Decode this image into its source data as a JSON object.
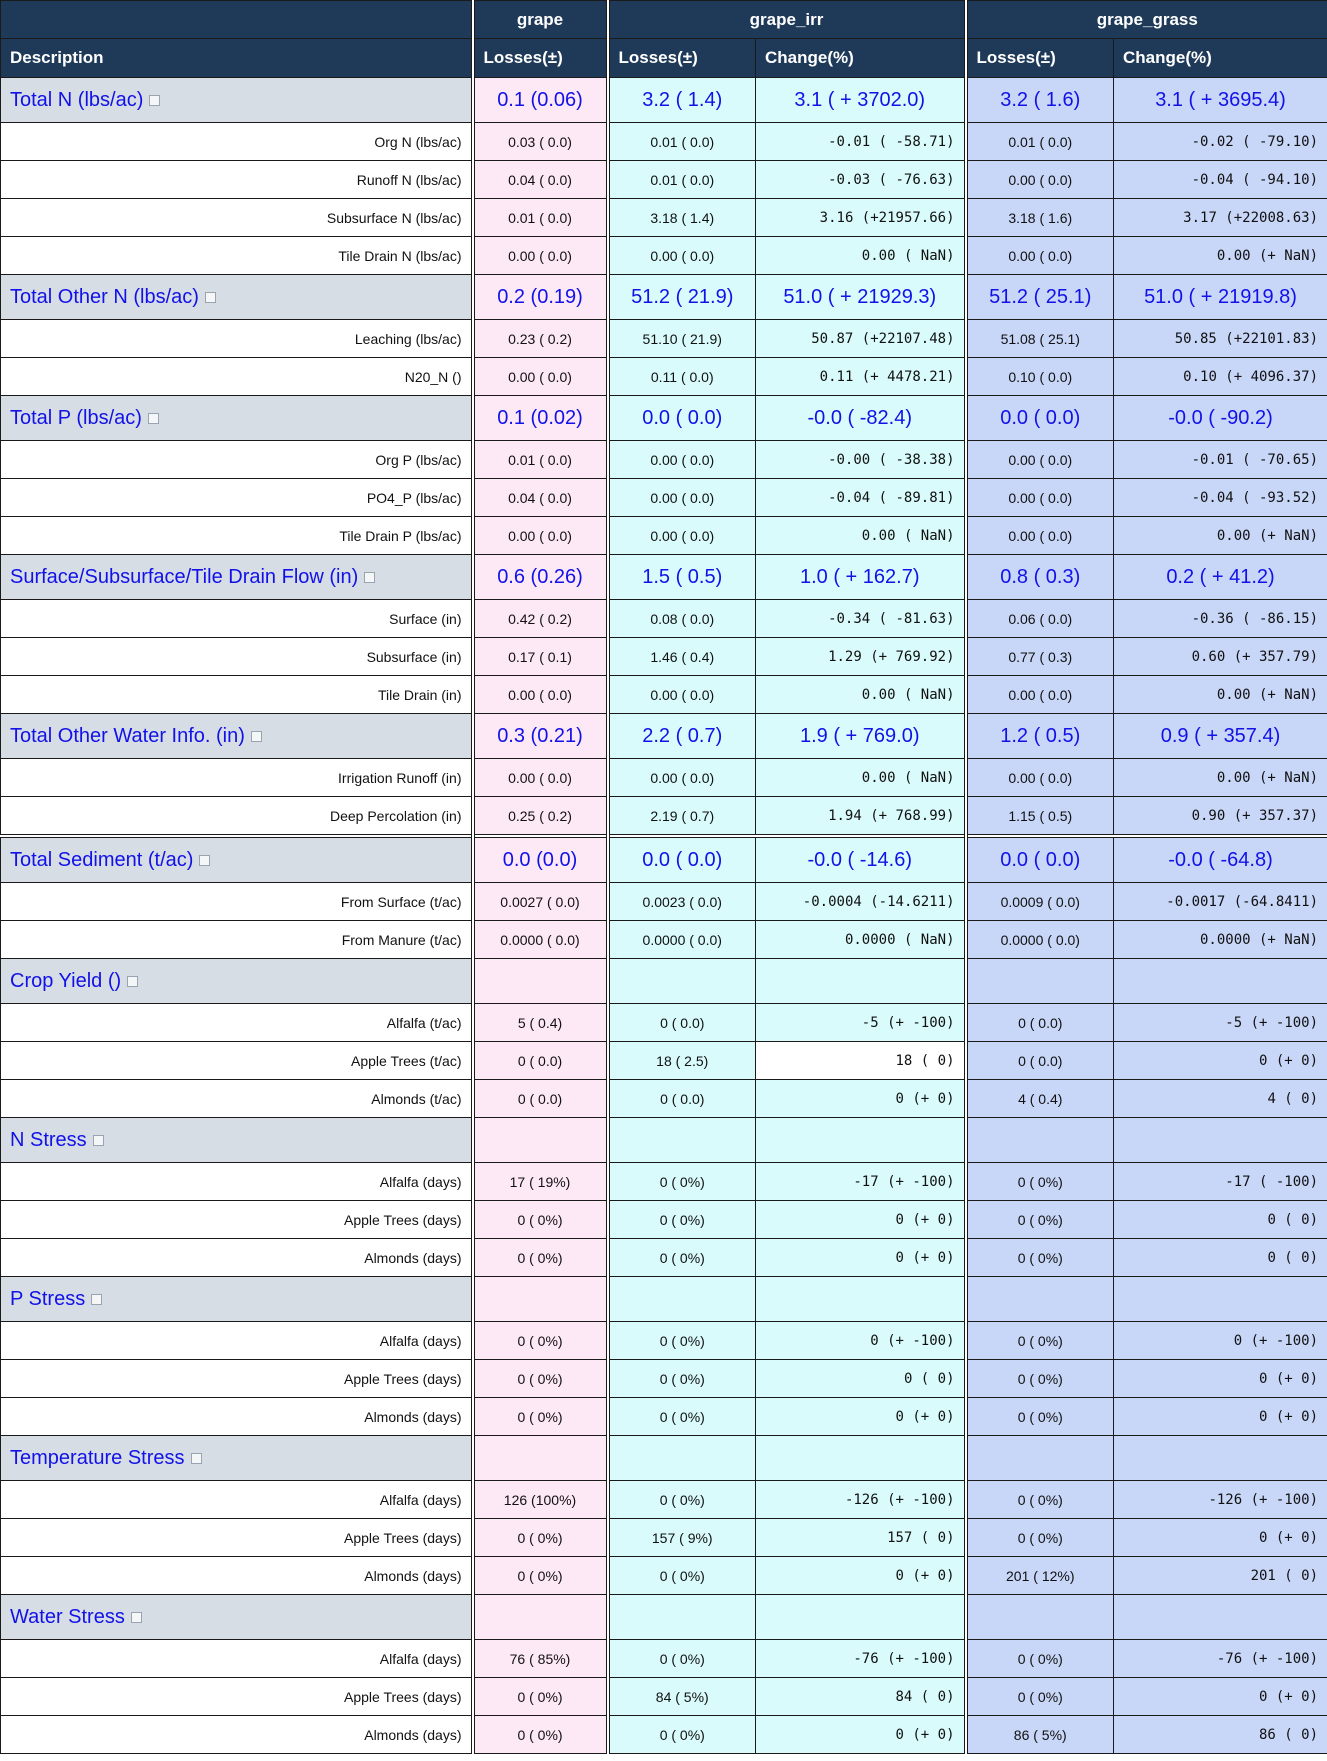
{
  "header": {
    "scenarios": [
      "grape",
      "grape_irr",
      "grape_grass"
    ],
    "description": "Description",
    "losses": "Losses(±)",
    "change": "Change(%)"
  },
  "groups": [
    {
      "label": "Total N (lbs/ac)",
      "summary": {
        "grape": "0.1 (0.06)",
        "irr_l": "3.2 ( 1.4)",
        "irr_c": "3.1 ( + 3702.0)",
        "grass_l": "3.2 ( 1.6)",
        "grass_c": "3.1 ( + 3695.4)"
      },
      "rows": [
        {
          "label": "Org N (lbs/ac)",
          "grape": "0.03 ( 0.0)",
          "irr_l": "0.01 ( 0.0)",
          "irr_c": "-0.01 ( -58.71)",
          "irr_c_color": "green",
          "grass_l": "0.01 ( 0.0)",
          "grass_c": "-0.02 ( -79.10)",
          "grass_c_color": "green"
        },
        {
          "label": "Runoff N (lbs/ac)",
          "grape": "0.04 ( 0.0)",
          "irr_l": "0.01 ( 0.0)",
          "irr_c": "-0.03 ( -76.63)",
          "irr_c_color": "green",
          "grass_l": "0.00 ( 0.0)",
          "grass_c": "-0.04 ( -94.10)",
          "grass_c_color": "green"
        },
        {
          "label": "Subsurface N (lbs/ac)",
          "grape": "0.01 ( 0.0)",
          "irr_l": "3.18 ( 1.4)",
          "irr_c": "3.16 (+21957.66)",
          "irr_c_color": "orange",
          "grass_l": "3.18 ( 1.6)",
          "grass_c": "3.17 (+22008.63)",
          "grass_c_color": "orange"
        },
        {
          "label": "Tile Drain N (lbs/ac)",
          "grape": "0.00 ( 0.0)",
          "irr_l": "0.00 ( 0.0)",
          "irr_c": "0.00 ( NaN)",
          "irr_c_color": "green",
          "grass_l": "0.00 ( 0.0)",
          "grass_c": "0.00 (+ NaN)",
          "grass_c_color": "orange"
        }
      ]
    },
    {
      "label": "Total Other N (lbs/ac)",
      "summary": {
        "grape": "0.2 (0.19)",
        "irr_l": "51.2 ( 21.9)",
        "irr_c": "51.0 ( + 21929.3)",
        "grass_l": "51.2 ( 25.1)",
        "grass_c": "51.0 ( + 21919.8)"
      },
      "rows": [
        {
          "label": "Leaching (lbs/ac)",
          "grape": "0.23 ( 0.2)",
          "irr_l": "51.10 ( 21.9)",
          "irr_c": "50.87 (+22107.48)",
          "irr_c_color": "orange",
          "grass_l": "51.08 ( 25.1)",
          "grass_c": "50.85 (+22101.83)",
          "grass_c_color": "orange"
        },
        {
          "label": "N20_N ()",
          "grape": "0.00 ( 0.0)",
          "irr_l": "0.11 ( 0.0)",
          "irr_c": "0.11 (+ 4478.21)",
          "irr_c_color": "orange",
          "grass_l": "0.10 ( 0.0)",
          "grass_c": "0.10 (+ 4096.37)",
          "grass_c_color": "orange"
        }
      ]
    },
    {
      "label": "Total P (lbs/ac)",
      "summary": {
        "grape": "0.1 (0.02)",
        "irr_l": "0.0 ( 0.0)",
        "irr_c": "-0.0 ( -82.4)",
        "grass_l": "0.0 ( 0.0)",
        "grass_c": "-0.0 ( -90.2)"
      },
      "rows": [
        {
          "label": "Org P (lbs/ac)",
          "grape": "0.01 ( 0.0)",
          "irr_l": "0.00 ( 0.0)",
          "irr_c": "-0.00 ( -38.38)",
          "irr_c_color": "green",
          "grass_l": "0.00 ( 0.0)",
          "grass_c": "-0.01 ( -70.65)",
          "grass_c_color": "green"
        },
        {
          "label": "PO4_P (lbs/ac)",
          "grape": "0.04 ( 0.0)",
          "irr_l": "0.00 ( 0.0)",
          "irr_c": "-0.04 ( -89.81)",
          "irr_c_color": "green",
          "grass_l": "0.00 ( 0.0)",
          "grass_c": "-0.04 ( -93.52)",
          "grass_c_color": "green"
        },
        {
          "label": "Tile Drain P (lbs/ac)",
          "grape": "0.00 ( 0.0)",
          "irr_l": "0.00 ( 0.0)",
          "irr_c": "0.00 ( NaN)",
          "irr_c_color": "green",
          "grass_l": "0.00 ( 0.0)",
          "grass_c": "0.00 (+ NaN)",
          "grass_c_color": "orange"
        }
      ]
    },
    {
      "label": "Surface/Subsurface/Tile Drain Flow (in)",
      "summary": {
        "grape": "0.6 (0.26)",
        "irr_l": "1.5 ( 0.5)",
        "irr_c": "1.0 ( + 162.7)",
        "grass_l": "0.8 ( 0.3)",
        "grass_c": "0.2 ( + 41.2)"
      },
      "rows": [
        {
          "label": "Surface (in)",
          "grape": "0.42 ( 0.2)",
          "irr_l": "0.08 ( 0.0)",
          "irr_c": "-0.34 ( -81.63)",
          "irr_c_color": "green",
          "grass_l": "0.06 ( 0.0)",
          "grass_c": "-0.36 ( -86.15)",
          "grass_c_color": "green"
        },
        {
          "label": "Subsurface (in)",
          "grape": "0.17 ( 0.1)",
          "irr_l": "1.46 ( 0.4)",
          "irr_c": "1.29 (+ 769.92)",
          "irr_c_color": "orange",
          "grass_l": "0.77 ( 0.3)",
          "grass_c": "0.60 (+ 357.79)",
          "grass_c_color": "orange"
        },
        {
          "label": "Tile Drain (in)",
          "grape": "0.00 ( 0.0)",
          "irr_l": "0.00 ( 0.0)",
          "irr_c": "0.00 ( NaN)",
          "irr_c_color": "green",
          "grass_l": "0.00 ( 0.0)",
          "grass_c": "0.00 (+ NaN)",
          "grass_c_color": "orange"
        }
      ]
    },
    {
      "label": "Total Other Water Info. (in)",
      "summary": {
        "grape": "0.3 (0.21)",
        "irr_l": "2.2 ( 0.7)",
        "irr_c": "1.9 ( + 769.0)",
        "grass_l": "1.2 ( 0.5)",
        "grass_c": "0.9 ( + 357.4)"
      },
      "rows": [
        {
          "label": "Irrigation Runoff (in)",
          "grape": "0.00 ( 0.0)",
          "irr_l": "0.00 ( 0.0)",
          "irr_c": "0.00 ( NaN)",
          "irr_c_color": "green",
          "grass_l": "0.00 ( 0.0)",
          "grass_c": "0.00 (+ NaN)",
          "grass_c_color": "orange"
        },
        {
          "label": "Deep Percolation (in)",
          "grape": "0.25 ( 0.2)",
          "irr_l": "2.19 ( 0.7)",
          "irr_c": "1.94 (+ 768.99)",
          "irr_c_color": "orange",
          "grass_l": "1.15 ( 0.5)",
          "grass_c": "0.90 (+ 357.37)",
          "grass_c_color": "orange"
        }
      ]
    },
    {
      "label": "Total Sediment (t/ac)",
      "summary": {
        "grape": "0.0 (0.0)",
        "irr_l": "0.0 ( 0.0)",
        "irr_c": "-0.0 ( -14.6)",
        "grass_l": "0.0 ( 0.0)",
        "grass_c": "-0.0 ( -64.8)"
      },
      "rows": [
        {
          "label": "From Surface (t/ac)",
          "grape": "0.0027 ( 0.0)",
          "irr_l": "0.0023 ( 0.0)",
          "irr_c": "-0.0004 (-14.6211)",
          "irr_c_color": "green",
          "grass_l": "0.0009 ( 0.0)",
          "grass_c": "-0.0017 (-64.8411)",
          "grass_c_color": "green"
        },
        {
          "label": "From Manure (t/ac)",
          "grape": "0.0000 ( 0.0)",
          "irr_l": "0.0000 ( 0.0)",
          "irr_c": "0.0000 ( NaN)",
          "irr_c_color": "green",
          "grass_l": "0.0000 ( 0.0)",
          "grass_c": "0.0000 (+ NaN)",
          "grass_c_color": "orange"
        }
      ]
    },
    {
      "label": "Crop Yield ()",
      "summary": {
        "grape": "",
        "irr_l": "",
        "irr_c": "",
        "grass_l": "",
        "grass_c": ""
      },
      "rows": [
        {
          "label": "Alfalfa (t/ac)",
          "grape": "5 ( 0.4)",
          "irr_l": "0 ( 0.0)",
          "irr_c": "-5 (+ -100)",
          "irr_c_color": "orange",
          "grass_l": "0 ( 0.0)",
          "grass_c": "-5 (+ -100)",
          "grass_c_color": "orange"
        },
        {
          "label": "Apple Trees (t/ac)",
          "grape": "0 ( 0.0)",
          "irr_l": "18 ( 2.5)",
          "irr_c": "18 ( 0)",
          "irr_c_color": "green",
          "irr_c_bg": "white",
          "grass_l": "0 ( 0.0)",
          "grass_c": "0 (+ 0)",
          "grass_c_color": "orange"
        },
        {
          "label": "Almonds (t/ac)",
          "grape": "0 ( 0.0)",
          "irr_l": "0 ( 0.0)",
          "irr_c": "0 (+ 0)",
          "irr_c_color": "orange",
          "grass_l": "4 ( 0.4)",
          "grass_c": "4 ( 0)",
          "grass_c_color": "green"
        }
      ]
    },
    {
      "label": "N Stress",
      "summary": {
        "grape": "",
        "irr_l": "",
        "irr_c": "",
        "grass_l": "",
        "grass_c": ""
      },
      "rows": [
        {
          "label": "Alfalfa (days)",
          "grape": "17 ( 19%)",
          "irr_l": "0 ( 0%)",
          "irr_c": "-17 (+ -100)",
          "irr_c_color": "orange",
          "grass_l": "0 ( 0%)",
          "grass_c": "-17 ( -100)",
          "grass_c_color": "green"
        },
        {
          "label": "Apple Trees (days)",
          "grape": "0 ( 0%)",
          "irr_l": "0 ( 0%)",
          "irr_c": "0 (+ 0)",
          "irr_c_color": "orange",
          "grass_l": "0 ( 0%)",
          "grass_c": "0 ( 0)",
          "grass_c_color": "green"
        },
        {
          "label": "Almonds (days)",
          "grape": "0 ( 0%)",
          "irr_l": "0 ( 0%)",
          "irr_c": "0 (+ 0)",
          "irr_c_color": "orange",
          "grass_l": "0 ( 0%)",
          "grass_c": "0 ( 0)",
          "grass_c_color": "green"
        }
      ]
    },
    {
      "label": "P Stress",
      "summary": {
        "grape": "",
        "irr_l": "",
        "irr_c": "",
        "grass_l": "",
        "grass_c": ""
      },
      "rows": [
        {
          "label": "Alfalfa (days)",
          "grape": "0 ( 0%)",
          "irr_l": "0 ( 0%)",
          "irr_c": "0 (+ -100)",
          "irr_c_color": "orange",
          "grass_l": "0 ( 0%)",
          "grass_c": "0 (+ -100)",
          "grass_c_color": "orange"
        },
        {
          "label": "Apple Trees (days)",
          "grape": "0 ( 0%)",
          "irr_l": "0 ( 0%)",
          "irr_c": "0 ( 0)",
          "irr_c_color": "green",
          "grass_l": "0 ( 0%)",
          "grass_c": "0 (+ 0)",
          "grass_c_color": "orange"
        },
        {
          "label": "Almonds (days)",
          "grape": "0 ( 0%)",
          "irr_l": "0 ( 0%)",
          "irr_c": "0 (+ 0)",
          "irr_c_color": "orange",
          "grass_l": "0 ( 0%)",
          "grass_c": "0 (+ 0)",
          "grass_c_color": "orange"
        }
      ]
    },
    {
      "label": "Temperature Stress",
      "summary": {
        "grape": "",
        "irr_l": "",
        "irr_c": "",
        "grass_l": "",
        "grass_c": ""
      },
      "rows": [
        {
          "label": "Alfalfa (days)",
          "grape": "126 (100%)",
          "irr_l": "0 ( 0%)",
          "irr_c": "-126 (+ -100)",
          "irr_c_color": "orange",
          "grass_l": "0 ( 0%)",
          "grass_c": "-126 (+ -100)",
          "grass_c_color": "orange"
        },
        {
          "label": "Apple Trees (days)",
          "grape": "0 ( 0%)",
          "irr_l": "157 ( 9%)",
          "irr_c": "157 ( 0)",
          "irr_c_color": "green",
          "grass_l": "0 ( 0%)",
          "grass_c": "0 (+ 0)",
          "grass_c_color": "orange"
        },
        {
          "label": "Almonds (days)",
          "grape": "0 ( 0%)",
          "irr_l": "0 ( 0%)",
          "irr_c": "0 (+ 0)",
          "irr_c_color": "orange",
          "grass_l": "201 ( 12%)",
          "grass_c": "201 ( 0)",
          "grass_c_color": "green"
        }
      ]
    },
    {
      "label": "Water Stress",
      "summary": {
        "grape": "",
        "irr_l": "",
        "irr_c": "",
        "grass_l": "",
        "grass_c": ""
      },
      "rows": [
        {
          "label": "Alfalfa (days)",
          "grape": "76 ( 85%)",
          "irr_l": "0 ( 0%)",
          "irr_c": "-76 (+ -100)",
          "irr_c_color": "orange",
          "grass_l": "0 ( 0%)",
          "grass_c": "-76 (+ -100)",
          "grass_c_color": "orange"
        },
        {
          "label": "Apple Trees (days)",
          "grape": "0 ( 0%)",
          "irr_l": "84 ( 5%)",
          "irr_c": "84 ( 0)",
          "irr_c_color": "green",
          "grass_l": "0 ( 0%)",
          "grass_c": "0 (+ 0)",
          "grass_c_color": "orange"
        },
        {
          "label": "Almonds (days)",
          "grape": "0 ( 0%)",
          "irr_l": "0 ( 0%)",
          "irr_c": "0 (+ 0)",
          "irr_c_color": "orange",
          "grass_l": "86 ( 5%)",
          "grass_c": "86 ( 0)",
          "grass_c_color": "green"
        }
      ]
    }
  ],
  "colors": {
    "header_bg": "#1e3a58",
    "group_text": "#1212e8",
    "grape_bg": "#fde8f6",
    "irr_bg": "#d9fbfb",
    "grass_bg": "#c8d6f8",
    "change_green": "#1e8a1e",
    "change_orange": "#f5922a"
  }
}
